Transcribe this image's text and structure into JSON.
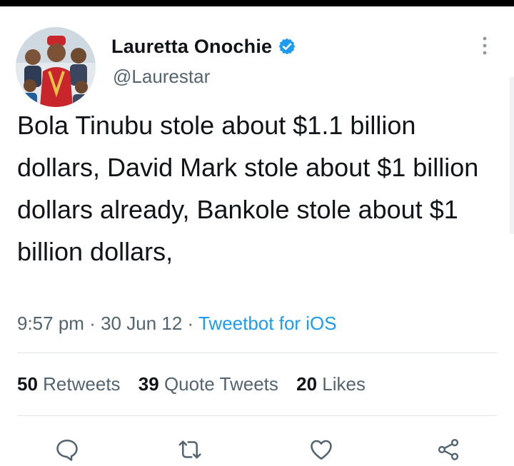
{
  "author": {
    "name": "Lauretta Onochie",
    "handle": "@Laurestar",
    "verified": true
  },
  "tweet": {
    "text": "Bola Tinubu stole about $1.1 billion dollars, David Mark stole about $1 billion dollars already, Bankole stole about $1 billion dollars,",
    "time": "9:57 pm",
    "date": "30 Jun 12",
    "separator": "·",
    "source": "Tweetbot for iOS"
  },
  "stats": {
    "retweets_count": "50",
    "retweets_label": "Retweets",
    "quote_count": "39",
    "quote_label": "Quote Tweets",
    "likes_count": "20",
    "likes_label": "Likes"
  },
  "icons": {
    "reply": "reply-icon",
    "retweet": "retweet-icon",
    "like": "like-icon",
    "share": "share-icon",
    "more": "more-icon",
    "verified": "verified-badge-icon"
  },
  "colors": {
    "text": "#0f1419",
    "secondary": "#536471",
    "accent": "#1d9bf0"
  }
}
